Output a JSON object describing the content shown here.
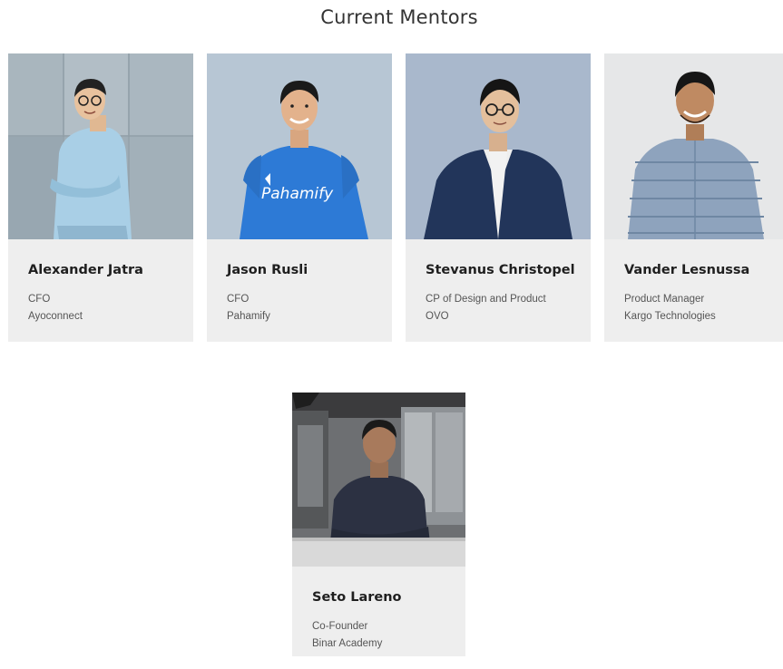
{
  "page": {
    "title": "Current Mentors"
  },
  "mentors": [
    {
      "name": "Alexander Jatra",
      "role": "CFO",
      "company": "Ayoconnect",
      "photo_icon": "mentor-photo"
    },
    {
      "name": "Jason Rusli",
      "role": "CFO",
      "company": "Pahamify",
      "photo_icon": "mentor-photo",
      "shirt_text": "Pahamify"
    },
    {
      "name": "Stevanus Christopel",
      "role": "CP of Design and Product",
      "company": "OVO",
      "photo_icon": "mentor-photo"
    },
    {
      "name": "Vander Lesnussa",
      "role": "Product Manager",
      "company": "Kargo Technologies",
      "photo_icon": "mentor-photo"
    },
    {
      "name": "Seto Lareno",
      "role": "Co-Founder",
      "company": "Binar Academy",
      "photo_icon": "mentor-photo"
    }
  ],
  "colors": {
    "card_background": "#eeeeee",
    "title_text": "#333333",
    "name_text": "#1f1f1f",
    "detail_text": "#555555"
  }
}
